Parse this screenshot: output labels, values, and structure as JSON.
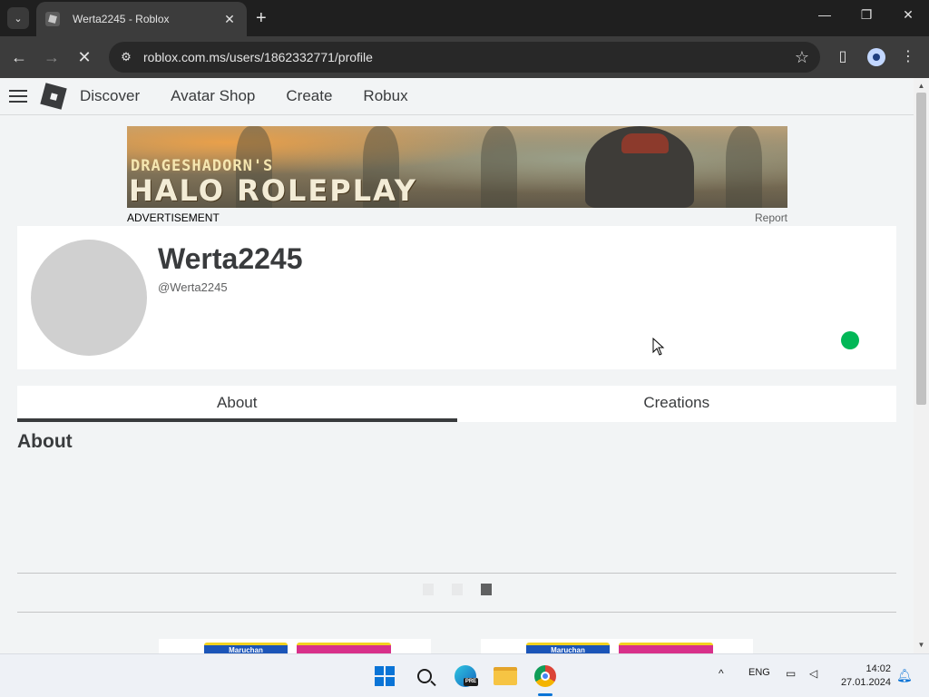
{
  "browser": {
    "tab_title": "Werta2245 - Roblox",
    "tab_close": "✕",
    "new_tab": "+",
    "url": "roblox.com.ms/users/1862332771/profile",
    "window_controls": {
      "minimize": "—",
      "maximize": "❐",
      "close": "✕"
    },
    "nav": {
      "back": "←",
      "forward": "→",
      "stop": "✕"
    },
    "star": "☆",
    "icons": [
      "tab-search-icon",
      "site-info-icon",
      "bookmark-star-icon",
      "side-panel-icon",
      "profile-icon",
      "menu-icon"
    ]
  },
  "site_header": {
    "nav_items": [
      "Discover",
      "Avatar Shop",
      "Create",
      "Robux"
    ]
  },
  "advertisement": {
    "banner_subtitle": "DRAGESHADORN'S",
    "banner_title": "HALO ROLEPLAY",
    "label": "ADVERTISEMENT",
    "report": "Report"
  },
  "profile": {
    "display_name": "Werta2245",
    "username": "@Werta2245",
    "status_color": "#02b757"
  },
  "tabs": [
    {
      "label": "About",
      "active": true
    },
    {
      "label": "Creations",
      "active": false
    }
  ],
  "about": {
    "heading": "About"
  },
  "carousel": {
    "dot_count": 3,
    "active_index": 2
  },
  "bottom_ads": {
    "brand": "Maruchan"
  },
  "taskbar": {
    "apps": [
      "windows-start-icon",
      "search-icon",
      "edge-beta-icon",
      "file-explorer-icon",
      "chrome-icon"
    ],
    "edge_badge": "PRE",
    "tray_chevron": "^",
    "language": "ENG",
    "time": "14:02",
    "date": "27.01.2024"
  },
  "colors": {
    "page_bg": "#f2f4f5",
    "text_primary": "#393b3d",
    "online_green": "#02b757"
  }
}
